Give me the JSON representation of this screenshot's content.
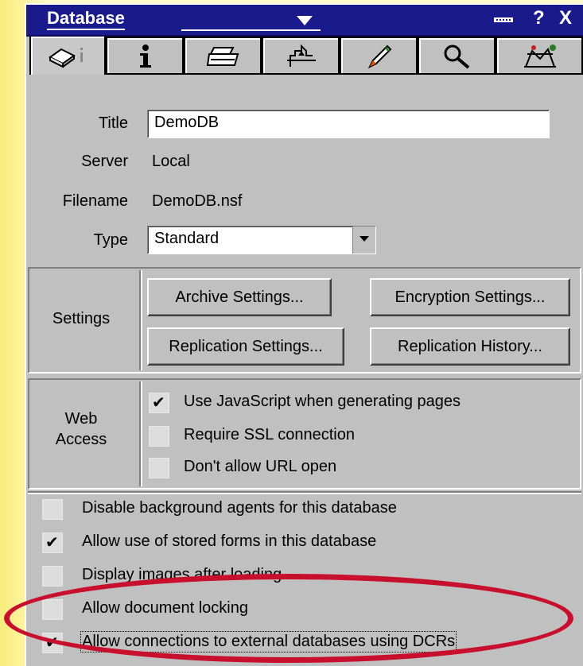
{
  "window": {
    "title": "Database",
    "help": "?",
    "close": "X"
  },
  "tabs": [
    {
      "icon": "database-info-icon",
      "active": true
    },
    {
      "icon": "info-icon"
    },
    {
      "icon": "printer-icon"
    },
    {
      "icon": "design-icon"
    },
    {
      "icon": "launch-icon"
    },
    {
      "icon": "search-icon"
    },
    {
      "icon": "advanced-icon"
    }
  ],
  "fields": {
    "title_label": "Title",
    "title_value": "DemoDB",
    "server_label": "Server",
    "server_value": "Local",
    "filename_label": "Filename",
    "filename_value": "DemoDB.nsf",
    "type_label": "Type",
    "type_value": "Standard"
  },
  "settings": {
    "label": "Settings",
    "archive": "Archive Settings...",
    "encryption": "Encryption Settings...",
    "replication": "Replication Settings...",
    "replication_history": "Replication History..."
  },
  "web_access": {
    "label_line1": "Web",
    "label_line2": "Access",
    "options": [
      {
        "label": "Use JavaScript when generating pages",
        "checked": true
      },
      {
        "label": "Require SSL connection",
        "checked": false
      },
      {
        "label": "Don't allow URL open",
        "checked": false
      }
    ]
  },
  "options": [
    {
      "label": "Disable background agents for this database",
      "checked": false
    },
    {
      "label": "Allow use of stored forms in this database",
      "checked": true
    },
    {
      "label": "Display images after loading",
      "checked": false
    },
    {
      "label": "Allow document locking",
      "checked": false
    },
    {
      "label": "Allow connections to external databases using DCRs",
      "checked": true
    }
  ],
  "colors": {
    "titlebar": "#1a1a8c",
    "panel": "#c0c0c0",
    "background": "#fffccc",
    "highlight_oval": "#c8102e"
  }
}
